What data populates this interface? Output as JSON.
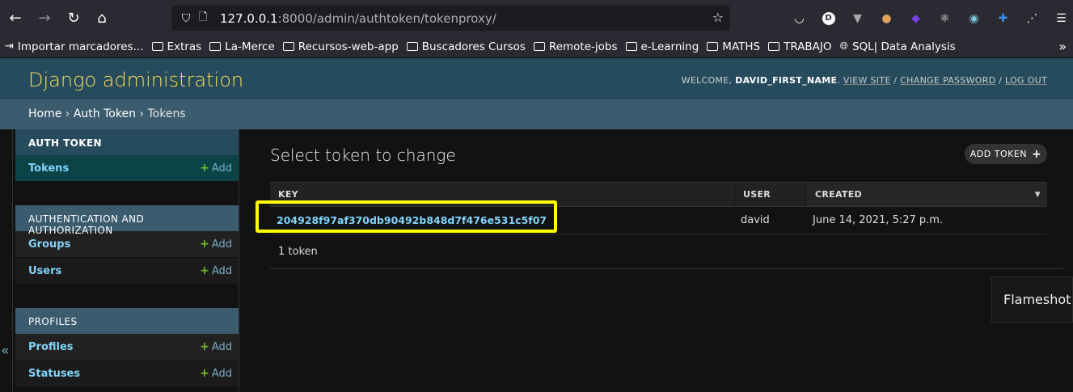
{
  "browser": {
    "back_icon": "arrow-left",
    "forward_icon": "arrow-right",
    "reload_icon": "reload",
    "home_icon": "home",
    "url_host": "127.0.0.1",
    "url_rest": ":8000/admin/authtoken/tokenproxy/",
    "bookmarks": [
      {
        "label": "Importar marcadores...",
        "icon": "import-icon"
      },
      {
        "label": "Extras",
        "icon": "folder-icon"
      },
      {
        "label": "La-Merce",
        "icon": "folder-icon"
      },
      {
        "label": "Recursos-web-app",
        "icon": "folder-icon"
      },
      {
        "label": "Buscadores Cursos",
        "icon": "folder-icon"
      },
      {
        "label": "Remote-jobs",
        "icon": "folder-icon"
      },
      {
        "label": "e-Learning",
        "icon": "folder-icon"
      },
      {
        "label": "MATHS",
        "icon": "folder-icon"
      },
      {
        "label": "TRABAJO",
        "icon": "folder-icon"
      },
      {
        "label": "SQL| Data Analysis",
        "icon": "globe-icon"
      }
    ],
    "extension_d_letter": "D"
  },
  "header": {
    "branding": "Django administration",
    "welcome": "WELCOME,",
    "username": "DAVID_FIRST_NAME",
    "view_site": "VIEW SITE",
    "change_password": "CHANGE PASSWORD",
    "log_out": "LOG OUT",
    "separator": "/"
  },
  "breadcrumbs": {
    "home": "Home",
    "app": "Auth Token",
    "model": "Tokens",
    "sep": "›"
  },
  "sidebar": {
    "collapse_glyph": "«",
    "modules": [
      {
        "caption": "AUTH TOKEN",
        "rows": [
          {
            "name": "Tokens",
            "add": "Add"
          }
        ]
      },
      {
        "caption": "AUTHENTICATION AND AUTHORIZATION",
        "rows": [
          {
            "name": "Groups",
            "add": "Add"
          },
          {
            "name": "Users",
            "add": "Add"
          }
        ]
      },
      {
        "caption": "PROFILES",
        "rows": [
          {
            "name": "Profiles",
            "add": "Add"
          },
          {
            "name": "Statuses",
            "add": "Add"
          }
        ]
      }
    ]
  },
  "content": {
    "title": "Select token to change",
    "add_button": "ADD TOKEN",
    "columns": {
      "key": "KEY",
      "user": "USER",
      "created": "CREATED"
    },
    "rows": [
      {
        "key": "204928f97af370db90492b848d7f476e531c5f07",
        "user": "david",
        "created": "June 14, 2021, 5:27 p.m."
      }
    ],
    "paginator": "1 token"
  },
  "overlay": {
    "flameshot": "Flameshot",
    "highlight_color": "#ffff00"
  },
  "colors": {
    "header_bg": "#264b5d",
    "branding": "#f5dd5d",
    "link": "#81d4fa",
    "add_plus": "#70bf2b"
  }
}
